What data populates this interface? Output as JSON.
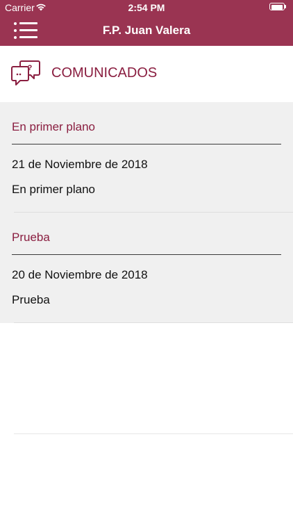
{
  "status_bar": {
    "carrier": "Carrier",
    "time": "2:54 PM",
    "wifi_icon": "wifi-icon",
    "battery_icon": "battery-icon"
  },
  "nav_bar": {
    "title": "F.P. Juan Valera",
    "menu_icon": "hamburger-menu-icon",
    "background_color": "#9a3452"
  },
  "section": {
    "title": "COMUNICADOS",
    "icon": "chat-question-icon",
    "accent_color": "#8a1e40"
  },
  "announcements": [
    {
      "title": "En primer plano",
      "date": "21 de Noviembre de 2018",
      "body": "En primer plano"
    },
    {
      "title": "Prueba",
      "date": "20 de Noviembre de 2018",
      "body": "Prueba"
    }
  ]
}
